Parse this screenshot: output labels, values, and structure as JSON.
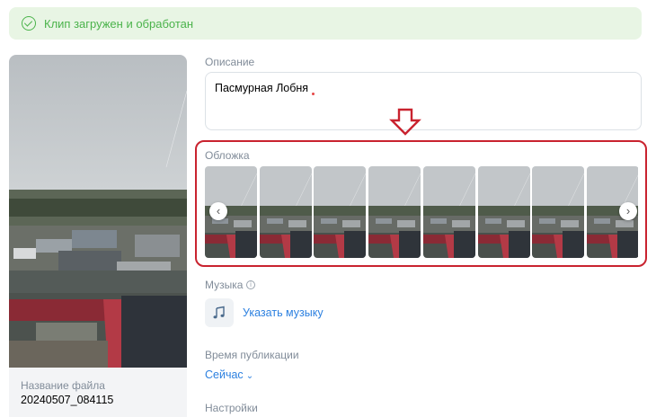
{
  "banner": {
    "text": "Клип загружен и обработан",
    "icon": "check-circle-icon"
  },
  "file": {
    "label": "Название файла",
    "name": "20240507_084115"
  },
  "description": {
    "label": "Описание",
    "value": "Пасмурная Лобня"
  },
  "cover": {
    "label": "Обложка",
    "frame_count": 8,
    "prev_glyph": "‹",
    "next_glyph": "›"
  },
  "music": {
    "label": "Музыка",
    "info_glyph": "i",
    "link": "Указать музыку"
  },
  "publish": {
    "label": "Время публикации",
    "value": "Сейчас"
  },
  "settings": {
    "label": "Настройки"
  },
  "colors": {
    "success": "#4bb34b",
    "success_bg": "#e8f5e4",
    "link": "#2d81e0",
    "muted": "#818c99",
    "highlight": "#c9232f"
  }
}
